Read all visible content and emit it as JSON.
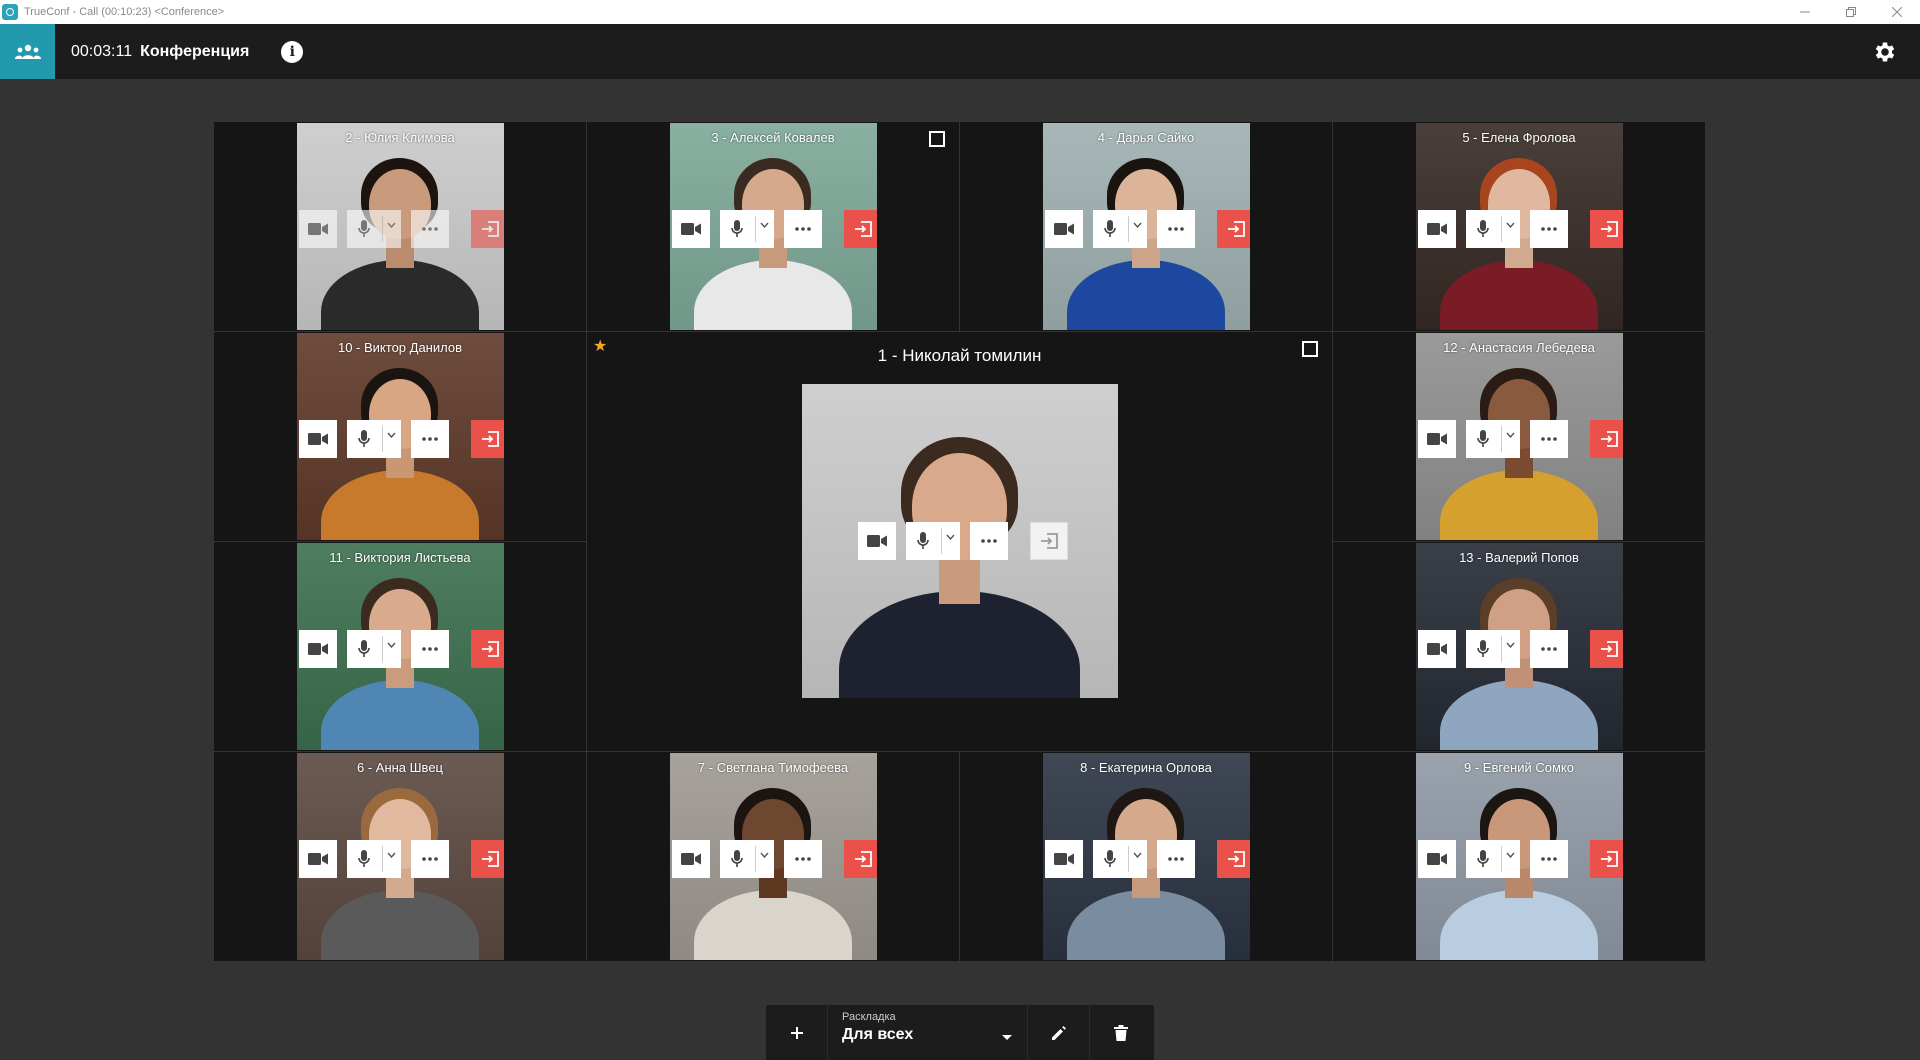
{
  "window": {
    "title": "TrueConf - Call (00:10:23) <Conference>",
    "controls": [
      "minimize",
      "restore",
      "close"
    ]
  },
  "header": {
    "timer": "00:03:11",
    "title": "Конференция"
  },
  "main": {
    "name": "1 - Николай томилин",
    "skin": "#d9a98c",
    "hair": "#3b2a20",
    "shirt": "#1e2230",
    "bg": "#cfcfcf",
    "leave_disabled": true
  },
  "participants": [
    {
      "name": "2 - Юлия Климова",
      "skin": "#c99a7c",
      "hair": "#1d1410",
      "shirt": "#2a2a2a",
      "bg": "#cfcfcf",
      "dim": true
    },
    {
      "name": "3 - Алексей Ковалев",
      "skin": "#d6a98d",
      "hair": "#3a2b22",
      "shirt": "#e8e8e8",
      "bg": "#8ab0a2",
      "checkbox": true
    },
    {
      "name": "4 - Дарья Сайко",
      "skin": "#dcb499",
      "hair": "#1a1411",
      "shirt": "#1e47a0",
      "bg": "#a8b7b8"
    },
    {
      "name": "5 - Елена Фролова",
      "skin": "#e0b8a0",
      "hair": "#a8451f",
      "shirt": "#7a1c25",
      "bg": "#4a3f3a"
    },
    {
      "name": "10 - Виктор Данилов",
      "skin": "#d8a682",
      "hair": "#1b1512",
      "shirt": "#c7792c",
      "bg": "#6e4d3f"
    },
    {
      "name": "12 - Анастасия Лебедева",
      "skin": "#8a5a3e",
      "hair": "#2a1b14",
      "shirt": "#d6a02e",
      "bg": "#9a9a9a"
    },
    {
      "name": "11 - Виктория Листьева",
      "skin": "#d9ab8c",
      "hair": "#3b2a1e",
      "shirt": "#4f86b3",
      "bg": "#4f7d5f"
    },
    {
      "name": "13 - Валерий Попов",
      "skin": "#cfa085",
      "hair": "#5a3e28",
      "shirt": "#8ea6c0",
      "bg": "#3a3f48"
    },
    {
      "name": "6 - Анна Швец",
      "skin": "#e1b99e",
      "hair": "#9a6a3e",
      "shirt": "#5a5a5a",
      "bg": "#6b5b52"
    },
    {
      "name": "7 - Светлана Тимофеева",
      "skin": "#6e4731",
      "hair": "#1b1411",
      "shirt": "#d9d4cc",
      "bg": "#a7a39c"
    },
    {
      "name": "8 - Екатерина Орлова",
      "skin": "#d5a98c",
      "hair": "#1f1713",
      "shirt": "#7a8da0",
      "bg": "#404855"
    },
    {
      "name": "9 - Евгений Сомко",
      "skin": "#c9977a",
      "hair": "#1c1612",
      "shirt": "#b8cde0",
      "bg": "#9aa3ad"
    }
  ],
  "toolbar": {
    "layout_label": "Раскладка",
    "layout_value": "Для всех"
  },
  "colors": {
    "accent": "#2399ad",
    "leave": "#e9514a",
    "star": "#f5a623"
  },
  "icons": {
    "participants": "people-icon",
    "info": "info-icon",
    "settings": "gear-icon",
    "camera": "camera-icon",
    "mic": "microphone-icon",
    "more": "more-dots-icon",
    "leave": "exit-icon"
  }
}
